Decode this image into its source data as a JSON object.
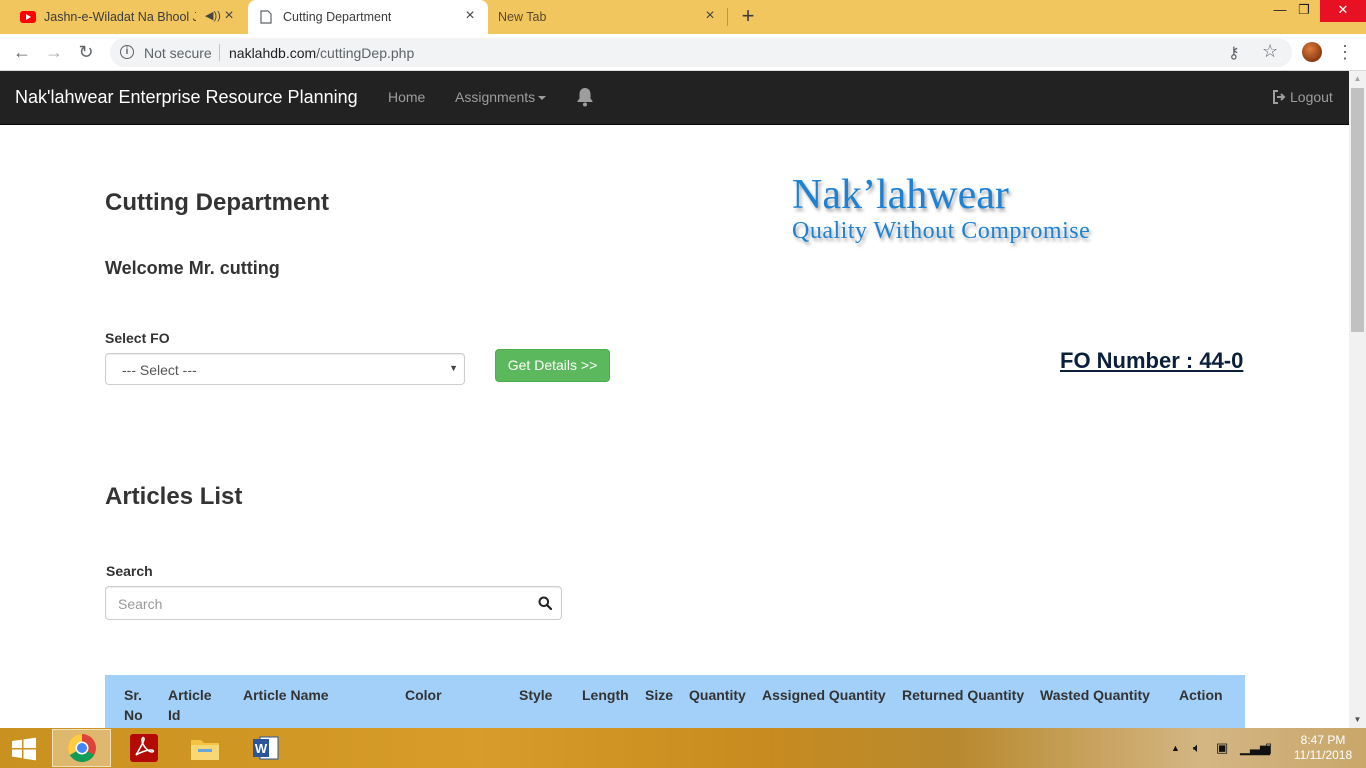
{
  "browser": {
    "tabs": [
      {
        "title": "Jashn-e-Wiladat Na Bhool Ja",
        "active": false
      },
      {
        "title": "Cutting Department",
        "active": true
      },
      {
        "title": "New Tab",
        "active": false
      }
    ],
    "security_label": "Not secure",
    "url_host": "naklahdb.com",
    "url_path": "/cuttingDep.php"
  },
  "navbar": {
    "brand": "Nak'lahwear Enterprise Resource Planning",
    "home": "Home",
    "assignments": "Assignments",
    "logout": "Logout"
  },
  "page": {
    "title": "Cutting Department",
    "welcome": "Welcome Mr. cutting",
    "logo_name": "Nak’lahwear",
    "logo_tagline": "Quality Without Compromise",
    "select_fo_label": "Select FO",
    "select_fo_value": "--- Select ---",
    "get_details": "Get Details >>",
    "fo_number": "FO Number : 44-0",
    "articles_title": "Articles List",
    "search_label": "Search",
    "search_placeholder": "Search"
  },
  "table": {
    "header_color": "#a3d0f9",
    "columns": [
      "Sr. No",
      "Article Id",
      "Article Name",
      "Color",
      "Style",
      "Length",
      "Size",
      "Quantity",
      "Assigned Quantity",
      "Returned Quantity",
      "Wasted Quantity",
      "Action"
    ],
    "col_sr_1": "Sr.",
    "col_sr_2": "No",
    "col_article_1": "Article",
    "col_article_2": "Id"
  },
  "taskbar": {
    "apps": [
      "chrome-icon",
      "acrobat-icon",
      "file-explorer-icon",
      "word-icon"
    ],
    "time": "8:47 PM",
    "date": "11/11/2018"
  },
  "colors": {
    "navbar_bg": "#222222",
    "success_button": "#5cb85c",
    "logo_blue": "#1e82d4",
    "tab_strip": "#f2c65e"
  }
}
